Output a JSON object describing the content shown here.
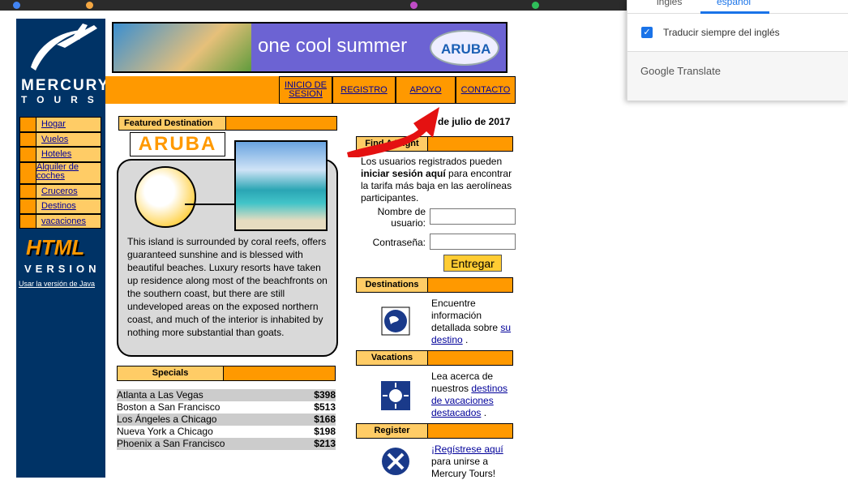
{
  "translate": {
    "tab_english": "inglés",
    "tab_spanish": "español",
    "always_translate": "Traducir siempre del inglés",
    "brand": "Google Translate"
  },
  "logo": {
    "line1": "MERCURY",
    "line2": "TOURS"
  },
  "nav": [
    {
      "label": "Hogar"
    },
    {
      "label": "Vuelos"
    },
    {
      "label": "Hoteles"
    },
    {
      "label": "Alquiler de coches"
    },
    {
      "label": "Cruceros"
    },
    {
      "label": "Destinos"
    },
    {
      "label": "vacaciones"
    }
  ],
  "html_version": {
    "line1": "HTML",
    "line2": "VERSION",
    "java_link": "Usar la versión de Java"
  },
  "banner": {
    "text": "one cool summer",
    "logo": "ARUBA"
  },
  "topmenu": {
    "login": "INICIO DE SESION",
    "register": "REGISTRO",
    "support": "APOYO",
    "contact": "CONTACTO"
  },
  "featured": {
    "header": "Featured Destination",
    "title": "ARUBA",
    "text": "This island is surrounded by coral reefs, offers guaranteed sunshine and is blessed with beautiful beaches. Luxury resorts have taken up residence along most of the beachfronts on the southern coast, but there are still undeveloped areas on the exposed northern coast, and much of the interior is inhabited by nothing more substantial than goats."
  },
  "specials": {
    "header": "Specials",
    "rows": [
      {
        "dest": "Atlanta a Las Vegas",
        "price": "$398"
      },
      {
        "dest": "Boston a San Francisco",
        "price": "$513"
      },
      {
        "dest": "Los Ángeles a Chicago",
        "price": "$168"
      },
      {
        "dest": "Nueva York a Chicago",
        "price": "$198"
      },
      {
        "dest": "Phoenix a San Francisco",
        "price": "$213"
      }
    ]
  },
  "date": "6 de julio de 2017",
  "find_flight": {
    "header": "Find A Flight",
    "text_pre": "Los usuarios registrados pueden ",
    "text_bold": "iniciar sesión aquí",
    "text_post": " para encontrar la tarifa más baja en las aerolíneas participantes.",
    "username_label": "Nombre de usuario:",
    "password_label": "Contraseña:",
    "submit": "Entregar"
  },
  "destinations": {
    "header": "Destinations",
    "text": "Encuentre información detallada sobre ",
    "link": "su destino",
    "tail": " ."
  },
  "vacations": {
    "header": "Vacations",
    "text": "Lea acerca de nuestros ",
    "link": "destinos de vacaciones destacados",
    "tail": " ."
  },
  "register": {
    "header": "Register",
    "link": "¡Regístrese aquí",
    "text": " para unirse a Mercury Tours!"
  }
}
